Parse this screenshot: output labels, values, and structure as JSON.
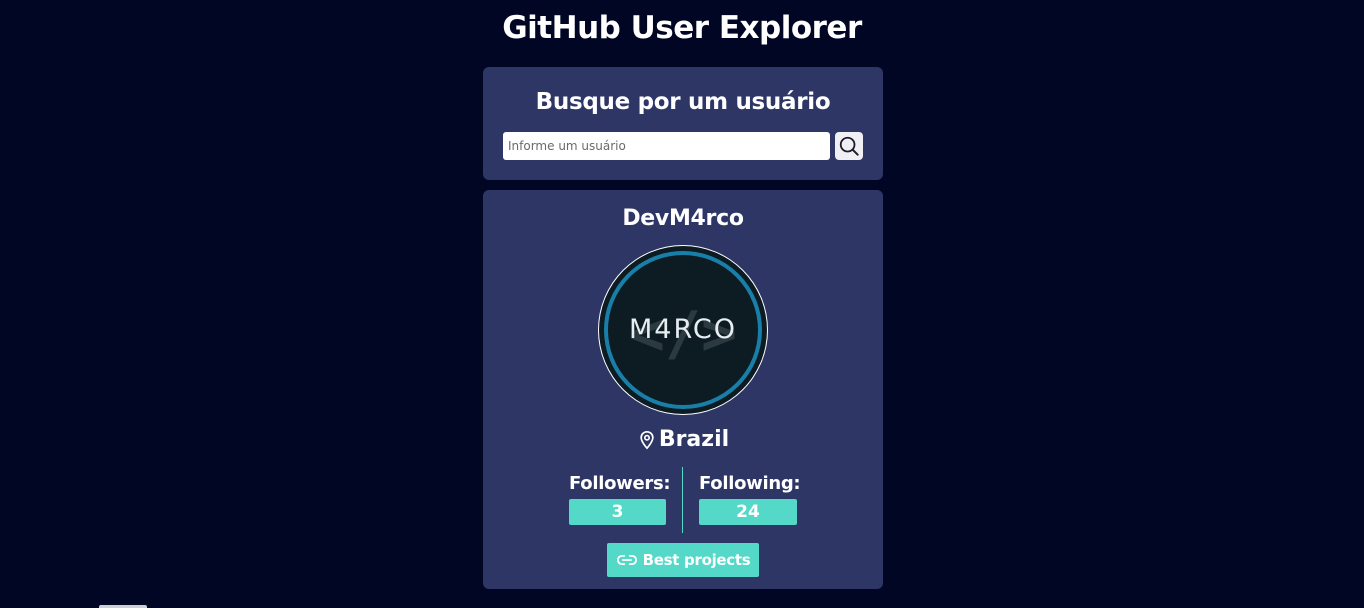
{
  "header": {
    "title": "GitHub User Explorer"
  },
  "search": {
    "heading": "Busque por um usuário",
    "placeholder": "Informe um usuário",
    "value": "",
    "button_icon": "search-icon"
  },
  "profile": {
    "username": "DevM4rco",
    "avatar_text": "M4RCO",
    "avatar_code_glyph": "</>",
    "location_icon": "map-pin-icon",
    "location": "Brazil",
    "followers_label": "Followers:",
    "followers_count": "3",
    "following_label": "Following:",
    "following_count": "24",
    "projects_icon": "link-icon",
    "projects_label": "Best projects"
  },
  "colors": {
    "background": "#000624",
    "card": "#2e3666",
    "accent": "#54d8c8",
    "avatar_ring": "#1a7fa8"
  }
}
